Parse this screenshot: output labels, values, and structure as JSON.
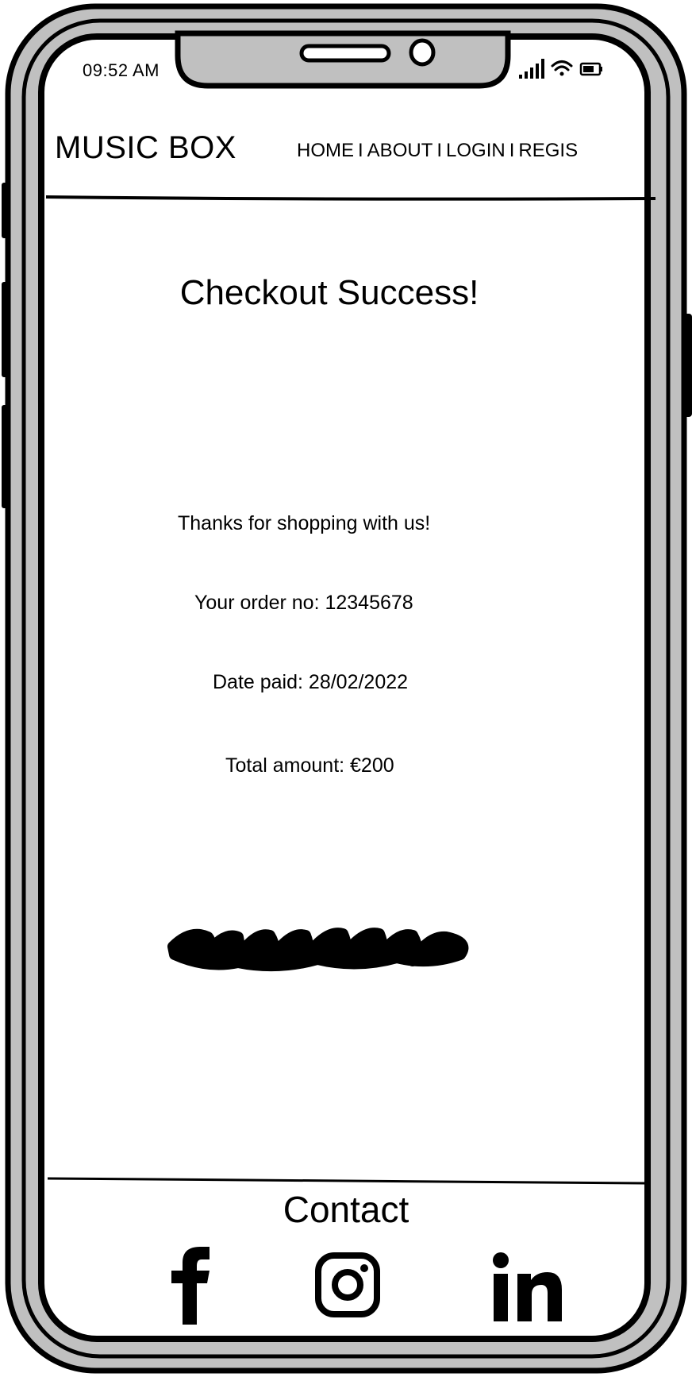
{
  "status_bar": {
    "time": "09:52 AM",
    "icons": [
      "signal-icon",
      "wifi-icon",
      "battery-icon"
    ]
  },
  "header": {
    "brand": "MUSIC BOX",
    "nav": [
      {
        "label": "HOME"
      },
      {
        "label": "ABOUT"
      },
      {
        "label": "LOGIN"
      },
      {
        "label": "REGIS"
      }
    ],
    "separator": "I"
  },
  "main": {
    "title": "Checkout Success!",
    "thanks": "Thanks for shopping with us!",
    "order_no": "Your order no: 12345678",
    "date_paid": "Date paid: 28/02/2022",
    "total": "Total amount: €200"
  },
  "footer": {
    "contact": "Contact",
    "social_icons": [
      "facebook-icon",
      "instagram-icon",
      "linkedin-icon"
    ]
  }
}
